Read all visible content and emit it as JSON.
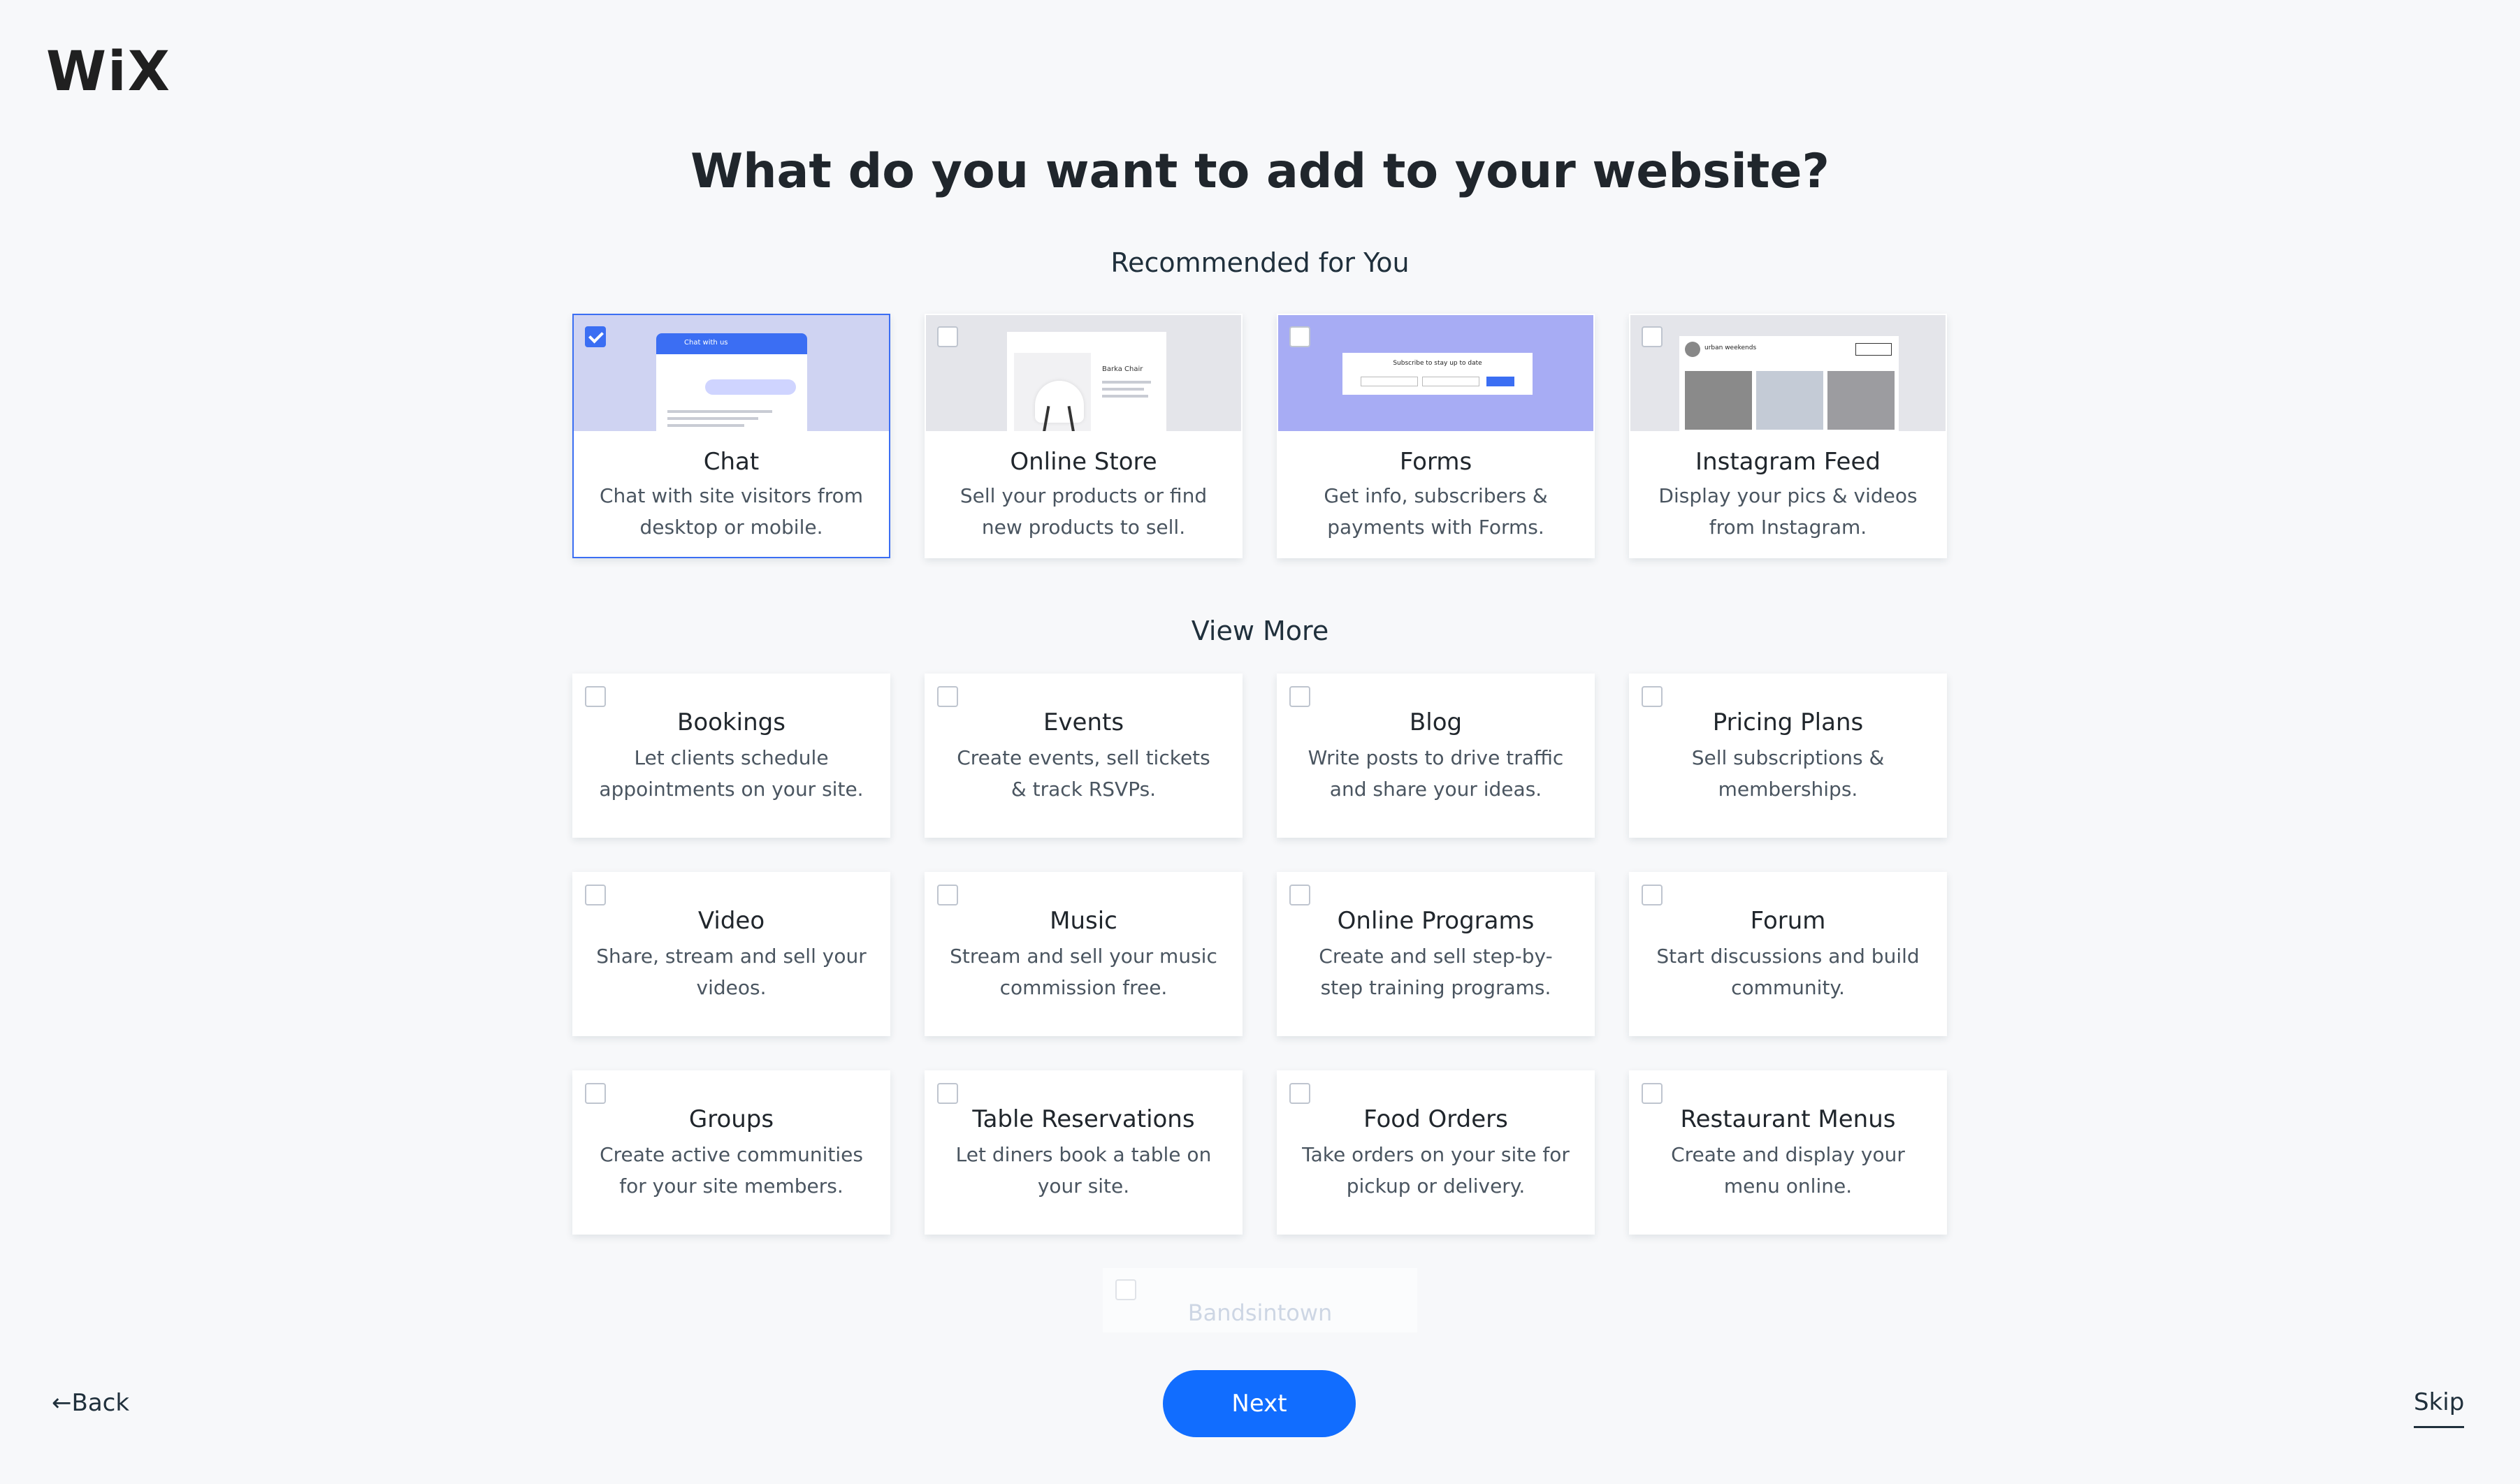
{
  "brand": {
    "logo": "WiX"
  },
  "title": "What do you want to add to your website?",
  "recommended": {
    "label": "Recommended for You",
    "items": [
      {
        "title": "Chat",
        "desc": "Chat with site visitors from desktop or mobile.",
        "checked": true,
        "thumb_text": "Chat with us"
      },
      {
        "title": "Online Store",
        "desc": "Sell your products or find new products to sell.",
        "checked": false,
        "thumb_text": "Barka Chair"
      },
      {
        "title": "Forms",
        "desc": "Get info, subscribers & payments with Forms.",
        "checked": false,
        "thumb_text": "Subscribe to stay up to date"
      },
      {
        "title": "Instagram Feed",
        "desc": "Display your pics & videos from Instagram.",
        "checked": false,
        "thumb_text": "urban weekends"
      }
    ]
  },
  "view_more": {
    "label": "View More",
    "items": [
      {
        "title": "Bookings",
        "desc": "Let clients schedule appointments on your site."
      },
      {
        "title": "Events",
        "desc": "Create events, sell tickets & track RSVPs."
      },
      {
        "title": "Blog",
        "desc": "Write posts to drive traffic and share your ideas."
      },
      {
        "title": "Pricing Plans",
        "desc": "Sell subscriptions & memberships."
      },
      {
        "title": "Video",
        "desc": "Share, stream and sell your videos."
      },
      {
        "title": "Music",
        "desc": "Stream and sell your music commission free."
      },
      {
        "title": "Online Programs",
        "desc": "Create and sell step-by-step training programs."
      },
      {
        "title": "Forum",
        "desc": "Start discussions and build community."
      },
      {
        "title": "Groups",
        "desc": "Create active communities for your site members."
      },
      {
        "title": "Table Reservations",
        "desc": "Let diners book a table on your site."
      },
      {
        "title": "Food Orders",
        "desc": "Take orders on your site for pickup or delivery."
      },
      {
        "title": "Restaurant Menus",
        "desc": "Create and display your menu online."
      }
    ],
    "partial_item": "Bandsintown"
  },
  "footer": {
    "back": "←Back",
    "next": "Next",
    "skip": "Skip"
  },
  "colors": {
    "accent": "#116dff",
    "selected_border": "#3b6ef3",
    "background": "#f7f8fa"
  }
}
